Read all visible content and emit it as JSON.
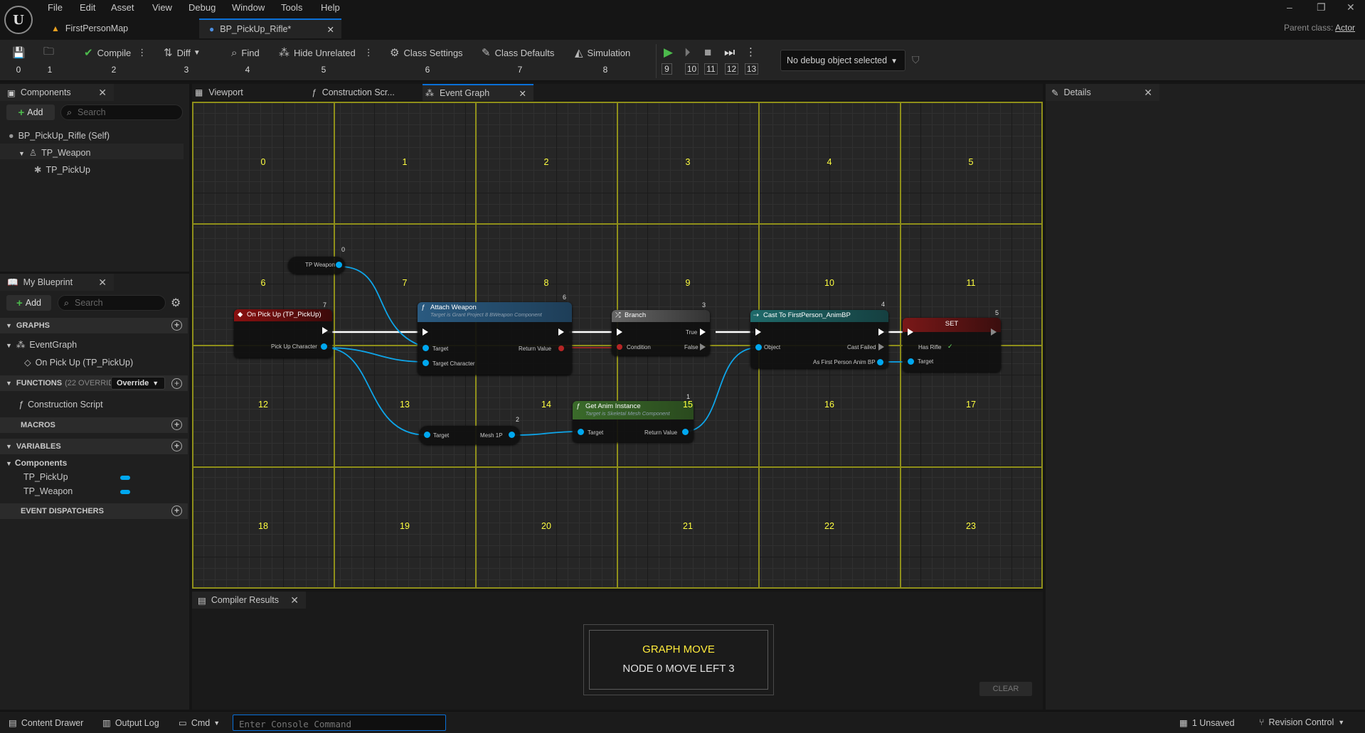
{
  "menu": [
    "File",
    "Edit",
    "Asset",
    "View",
    "Debug",
    "Window",
    "Tools",
    "Help"
  ],
  "tabs": {
    "map": "FirstPersonMap",
    "blueprint": "BP_PickUp_Rifle*"
  },
  "parent_class": {
    "label": "Parent class:",
    "value": "Actor"
  },
  "toolbar": {
    "compile": "Compile",
    "diff": "Diff",
    "find": "Find",
    "hide_unrelated": "Hide Unrelated",
    "class_settings": "Class Settings",
    "class_defaults": "Class Defaults",
    "simulation": "Simulation",
    "debug_object": "No debug object selected",
    "nums": [
      "0",
      "1",
      "2",
      "3",
      "4",
      "5",
      "6",
      "7",
      "8",
      "9",
      "10",
      "11",
      "12",
      "13"
    ]
  },
  "components": {
    "title": "Components",
    "add": "Add",
    "search_placeholder": "Search",
    "items": [
      "BP_PickUp_Rifle (Self)",
      "TP_Weapon",
      "TP_PickUp"
    ]
  },
  "my_blueprint": {
    "title": "My Blueprint",
    "add": "Add",
    "search_placeholder": "Search",
    "graphs": "GRAPHS",
    "event_graph": "EventGraph",
    "event_item": "On Pick Up (TP_PickUp)",
    "functions": "FUNCTIONS",
    "functions_count": "(22 OVERRIDA",
    "override": "Override",
    "construction_script": "Construction Script",
    "macros": "MACROS",
    "variables": "VARIABLES",
    "var_group": "Components",
    "vars": [
      "TP_PickUp",
      "TP_Weapon"
    ],
    "dispatchers": "EVENT DISPATCHERS"
  },
  "graph_tabs": {
    "viewport": "Viewport",
    "construction": "Construction Scr...",
    "event_graph": "Event Graph"
  },
  "grid_cells": [
    "0",
    "1",
    "2",
    "3",
    "4",
    "5",
    "6",
    "7",
    "8",
    "9",
    "10",
    "11",
    "12",
    "13",
    "14",
    "15",
    "16",
    "17",
    "18",
    "19",
    "20",
    "21",
    "22",
    "23"
  ],
  "nodes": {
    "tpweapon": {
      "badge": "0",
      "pin": "TP Weapon"
    },
    "event": {
      "badge": "7",
      "title": "On Pick Up (TP_PickUp)",
      "pin": "Pick Up Character"
    },
    "attach": {
      "badge": "6",
      "title": "Attach Weapon",
      "sub": "Target is Grant Project 8 BWeapon Component",
      "target": "Target",
      "target_char": "Target Character",
      "ret": "Return Value"
    },
    "branch": {
      "badge": "3",
      "title": "Branch",
      "cond": "Condition",
      "t": "True",
      "f": "False"
    },
    "cast": {
      "badge": "4",
      "title": "Cast To FirstPerson_AnimBP",
      "obj": "Object",
      "failed": "Cast Failed",
      "as": "As First Person Anim BP"
    },
    "set": {
      "badge": "5",
      "title": "SET",
      "hasrifle": "Has Rifle",
      "target": "Target"
    },
    "getmesh": {
      "badge": "2",
      "target": "Target",
      "mesh": "Mesh 1P"
    },
    "animinst": {
      "badge": "1",
      "title": "Get Anim Instance",
      "sub": "Target is Skeletal Mesh Component",
      "target": "Target",
      "ret": "Return Value"
    }
  },
  "compiler": {
    "title": "Compiler Results",
    "clear": "CLEAR"
  },
  "toast": {
    "title": "GRAPH MOVE",
    "message": "NODE 0 MOVE LEFT 3"
  },
  "details": {
    "title": "Details"
  },
  "statusbar": {
    "content_drawer": "Content Drawer",
    "output_log": "Output Log",
    "cmd": "Cmd",
    "console_placeholder": "Enter Console Command",
    "unsaved": "1 Unsaved",
    "revision": "Revision Control"
  }
}
